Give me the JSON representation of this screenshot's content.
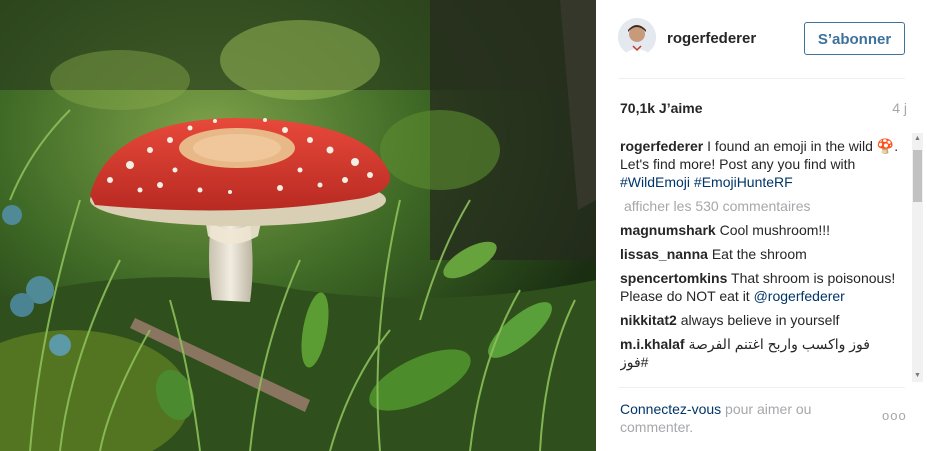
{
  "post": {
    "username": "rogerfederer",
    "follow_label": "S’abonner",
    "likes": "70,1k J’aime",
    "age": "4 j",
    "caption": {
      "author": "rogerfederer",
      "text_1": " I found an emoji in the wild ",
      "emoji": "🍄",
      "text_2": ". Let's find more! Post any you find with ",
      "tag_1": "#WildEmoji",
      "tag_2": "#EmojiHunteRF"
    },
    "load_more_label": "afficher les 530 commentaires",
    "comments": [
      {
        "author": "magnumshark",
        "text": "Cool mushroom!!!"
      },
      {
        "author": "lissas_nanna",
        "text": "Eat the shroom"
      },
      {
        "author": "spencertomkins",
        "text": "That shroom is poisonous! Please do NOT eat it",
        "mention": "@rogerfederer"
      },
      {
        "author": "nikkitat2",
        "text": "always believe in yourself"
      },
      {
        "author": "m.i.khalaf",
        "text": "فوز واكسب واربح اغتنم الفرصة #فوز"
      }
    ],
    "footer": {
      "login_link": "Connectez-vous",
      "login_text": " pour aimer ou commenter.",
      "more_label": "ooo"
    }
  },
  "icons": {
    "more": "more-options-icon",
    "scroll_up": "scroll-up-arrow-icon",
    "scroll_down": "scroll-down-arrow-icon"
  },
  "colors": {
    "link": "#003569",
    "button": "#3f729b",
    "muted": "#a5a7aa",
    "mushroom_cap": "#d8342a"
  }
}
